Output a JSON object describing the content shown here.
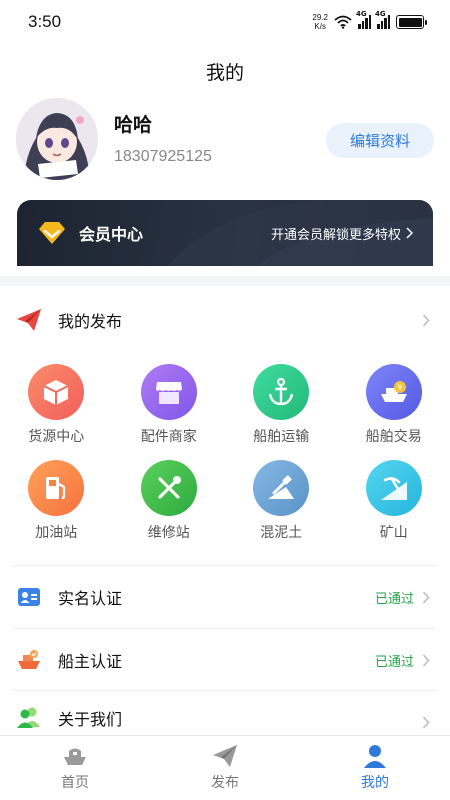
{
  "status_bar": {
    "time": "3:50",
    "net_speed_value": "29.2",
    "net_speed_unit": "K/s",
    "signal_tag": "4G",
    "signal_tag2": "4G"
  },
  "header": {
    "title": "我的"
  },
  "profile": {
    "name": "哈哈",
    "phone": "18307925125",
    "edit_label": "编辑资料"
  },
  "vip": {
    "title": "会员中心",
    "promo": "开通会员解锁更多特权"
  },
  "publish": {
    "label": "我的发布"
  },
  "services": [
    {
      "label": "货源中心",
      "icon": "box-icon",
      "color": "#f77461"
    },
    {
      "label": "配件商家",
      "icon": "shop-icon",
      "color": "#9b6bef"
    },
    {
      "label": "船舶运输",
      "icon": "anchor-icon",
      "color": "#2fcf89"
    },
    {
      "label": "船舶交易",
      "icon": "ship-trade-icon",
      "color": "#6b6ff2"
    },
    {
      "label": "加油站",
      "icon": "fuel-pump-icon",
      "color": "#fb8a52"
    },
    {
      "label": "维修站",
      "icon": "tools-icon",
      "color": "#3fc34e"
    },
    {
      "label": "混泥土",
      "icon": "concrete-icon",
      "color": "#69a6d8"
    },
    {
      "label": "矿山",
      "icon": "mine-icon",
      "color": "#36c9e8"
    }
  ],
  "list": [
    {
      "label": "实名认证",
      "status": "已通过",
      "icon": "id-card-icon"
    },
    {
      "label": "船主认证",
      "status": "已通过",
      "icon": "ship-owner-icon"
    },
    {
      "label": "关于我们",
      "status": "",
      "icon": "people-icon"
    }
  ],
  "tabbar": {
    "items": [
      {
        "label": "首页",
        "icon": "ship-home-icon"
      },
      {
        "label": "发布",
        "icon": "paper-plane-icon"
      },
      {
        "label": "我的",
        "icon": "user-icon"
      }
    ],
    "active_index": 2
  },
  "colors": {
    "accent": "#2f79db",
    "success": "#27a34b",
    "vip_dark": "#1c2431",
    "vip_gold": "#f5b81c"
  }
}
